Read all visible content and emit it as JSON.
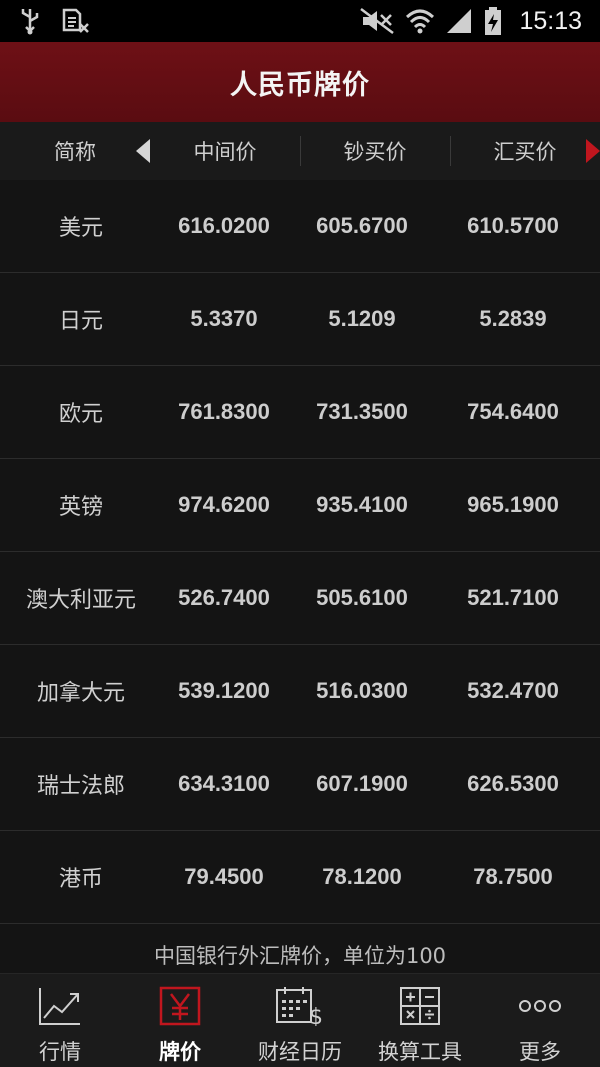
{
  "status_bar": {
    "time": "15:13",
    "icons": [
      "usb-icon",
      "sim-off-icon",
      "mute-icon",
      "wifi-icon",
      "signal-icon",
      "battery-charging-icon"
    ]
  },
  "header": {
    "title": "人民币牌价"
  },
  "columns": {
    "name": "简称",
    "mid": "中间价",
    "cash_buy": "钞买价",
    "transfer_buy": "汇买价"
  },
  "rows": [
    {
      "name": "美元",
      "mid": "616.0200",
      "cash_buy": "605.6700",
      "transfer_buy": "610.5700"
    },
    {
      "name": "日元",
      "mid": "5.3370",
      "cash_buy": "5.1209",
      "transfer_buy": "5.2839"
    },
    {
      "name": "欧元",
      "mid": "761.8300",
      "cash_buy": "731.3500",
      "transfer_buy": "754.6400"
    },
    {
      "name": "英镑",
      "mid": "974.6200",
      "cash_buy": "935.4100",
      "transfer_buy": "965.1900"
    },
    {
      "name": "澳大利亚元",
      "mid": "526.7400",
      "cash_buy": "505.6100",
      "transfer_buy": "521.7100"
    },
    {
      "name": "加拿大元",
      "mid": "539.1200",
      "cash_buy": "516.0300",
      "transfer_buy": "532.4700"
    },
    {
      "name": "瑞士法郎",
      "mid": "634.3100",
      "cash_buy": "607.1900",
      "transfer_buy": "626.5300"
    },
    {
      "name": "港币",
      "mid": "79.4500",
      "cash_buy": "78.1200",
      "transfer_buy": "78.7500"
    }
  ],
  "footnote": "中国银行外汇牌价，单位为100",
  "bottom_nav": [
    {
      "label": "行情",
      "icon": "trend-chart-icon",
      "active": false
    },
    {
      "label": "牌价",
      "icon": "yuan-icon",
      "active": true
    },
    {
      "label": "财经日历",
      "icon": "calendar-dollar-icon",
      "active": false
    },
    {
      "label": "换算工具",
      "icon": "calculator-icon",
      "active": false
    },
    {
      "label": "更多",
      "icon": "more-dots-icon",
      "active": false
    }
  ],
  "colors": {
    "accent": "#c0161e",
    "header_bg": "#6e1016",
    "background": "#141414"
  }
}
